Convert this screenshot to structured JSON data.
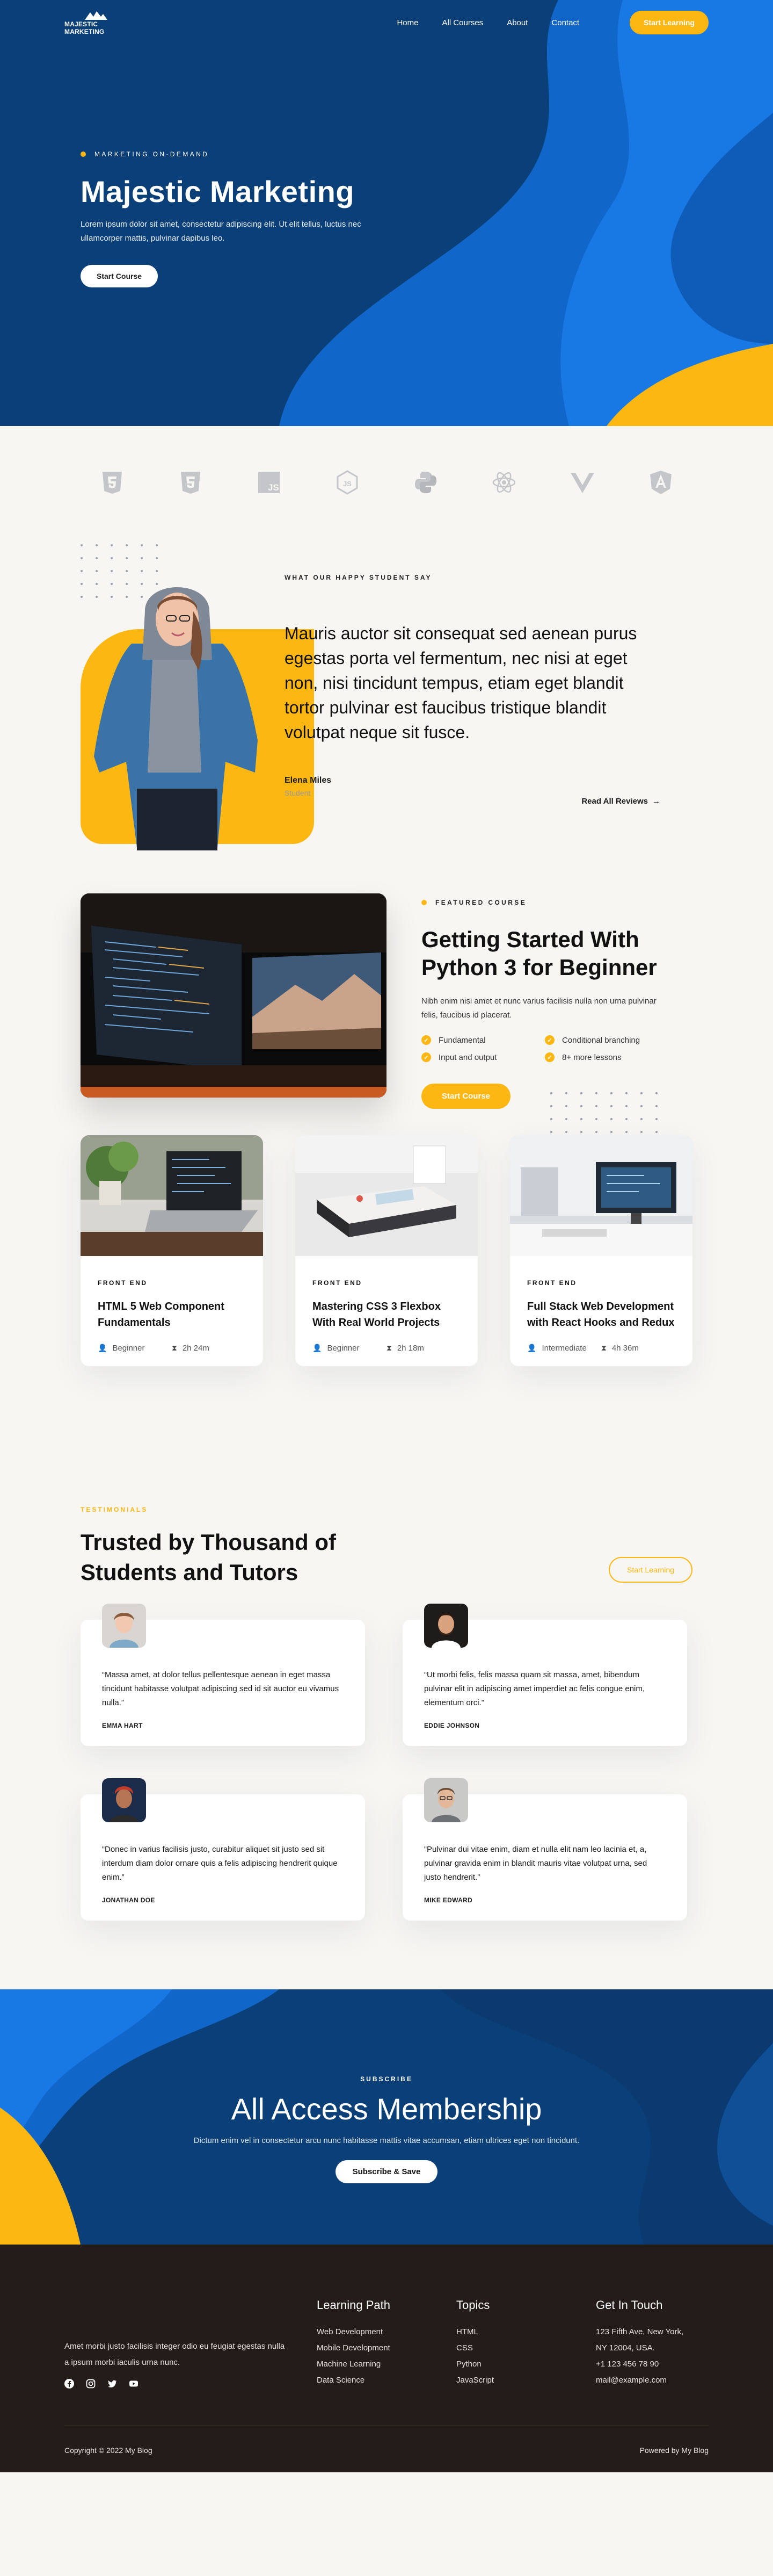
{
  "nav": {
    "logo_text": "MAJESTIC MARKETING",
    "links": [
      "Home",
      "All Courses",
      "About",
      "Contact"
    ],
    "cta": "Start Learning"
  },
  "hero": {
    "eyebrow": "MARKETING ON-DEMAND",
    "title": "Majestic Marketing",
    "subtitle": "Lorem ipsum dolor sit amet, consectetur adipiscing elit. Ut elit tellus, luctus nec ullamcorper mattis, pulvinar dapibus leo.",
    "button": "Start Course"
  },
  "tech_logos": [
    "html5-icon",
    "css3-icon",
    "javascript-icon",
    "nodejs-icon",
    "python-icon",
    "react-icon",
    "vue-icon",
    "angular-icon"
  ],
  "student_review": {
    "eyebrow": "WHAT OUR HAPPY STUDENT SAY",
    "quote": "Mauris auctor sit consequat sed aenean purus egestas porta vel fermentum, nec nisi at eget non, nisi tincidunt tempus, etiam eget blandit tortor pulvinar est faucibus tristique blandit volutpat neque sit fusce.",
    "author": "Elena Miles",
    "role": "Student",
    "read_all": "Read All Reviews"
  },
  "featured_course": {
    "eyebrow": "FEATURED COURSE",
    "title": "Getting Started With Python 3 for Beginner",
    "description": "Nibh enim nisi amet et nunc varius facilisis nulla non urna pulvinar felis, faucibus id placerat.",
    "features": [
      "Fundamental",
      "Conditional branching",
      "Input and output",
      "8+ more lessons"
    ],
    "button": "Start Course"
  },
  "courses": [
    {
      "category": "FRONT END",
      "title": "HTML 5 Web Component Fundamentals",
      "level": "Beginner",
      "duration": "2h 24m"
    },
    {
      "category": "FRONT END",
      "title": "Mastering CSS 3 Flexbox With Real World Projects",
      "level": "Beginner",
      "duration": "2h 18m"
    },
    {
      "category": "FRONT END",
      "title": "Full Stack Web Development with React Hooks and Redux",
      "level": "Intermediate",
      "duration": "4h 36m"
    }
  ],
  "testimonials": {
    "eyebrow": "TESTIMONIALS",
    "title": "Trusted by Thousand of Students and Tutors",
    "button": "Start Learning",
    "items": [
      {
        "quote": "“Massa amet, at dolor tellus pellentesque aenean in eget massa tincidunt habitasse volutpat adipiscing sed id sit auctor eu vivamus nulla.”",
        "name": "EMMA HART"
      },
      {
        "quote": "“Ut morbi felis, felis massa quam sit massa, amet, bibendum pulvinar elit in adipiscing amet imperdiet ac felis congue enim, elementum orci.”",
        "name": "EDDIE JOHNSON"
      },
      {
        "quote": "“Donec in varius facilisis justo, curabitur aliquet sit justo sed sit interdum diam dolor ornare quis a felis adipiscing hendrerit quique enim.”",
        "name": "JONATHAN DOE"
      },
      {
        "quote": "“Pulvinar dui vitae enim, diam et nulla elit nam leo lacinia et, a, pulvinar gravida enim in blandit mauris vitae volutpat urna, sed justo hendrerit.”",
        "name": "MIKE EDWARD"
      }
    ]
  },
  "membership": {
    "eyebrow": "SUBSCRIBE",
    "title": "All Access Membership",
    "subtitle": "Dictum enim vel in consectetur arcu nunc habitasse mattis vitae accumsan, etiam ultrices eget non tincidunt.",
    "button": "Subscribe & Save"
  },
  "footer": {
    "about": "Amet morbi justo facilisis integer odio eu feugiat egestas nulla a ipsum morbi iaculis urna nunc.",
    "columns": [
      {
        "title": "Learning Path",
        "items": [
          "Web Development",
          "Mobile Development",
          "Machine Learning",
          "Data Science"
        ]
      },
      {
        "title": "Topics",
        "items": [
          "HTML",
          "CSS",
          "Python",
          "JavaScript"
        ]
      },
      {
        "title": "Get In Touch",
        "items": [
          "123 Fifth Ave, New York,",
          "NY 12004, USA.",
          "+1 123 456 78 90",
          "mail@example.com"
        ]
      }
    ],
    "copyright": "Copyright © 2022 My Blog",
    "powered": "Powered by My Blog"
  },
  "colors": {
    "primary_blue": "#0d4a8c",
    "bright_blue": "#1777e0",
    "accent_yellow": "#fcb713",
    "footer_dark": "#231c18",
    "page_bg": "#f7f6f3"
  }
}
